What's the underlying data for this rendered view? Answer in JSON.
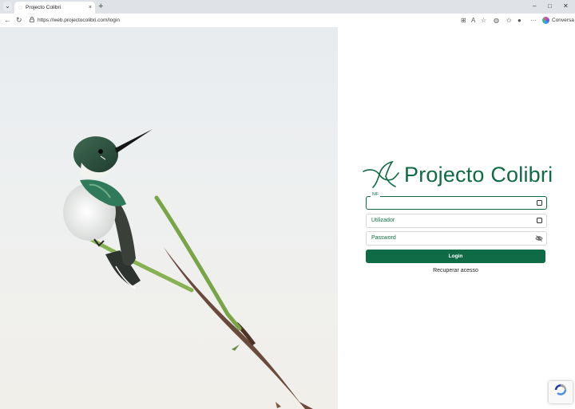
{
  "browser": {
    "tab_title": "Projecto Colibri",
    "tab_close": "×",
    "new_tab": "+",
    "tab_menu": "⌄",
    "url": "https://web.projectocolibri.com/login",
    "toolbar_more": "···",
    "copilot_label": "Conversa",
    "window_controls": {
      "minimize": "–",
      "maximize": "□",
      "close": "✕"
    },
    "nav": {
      "back": "←",
      "refresh": "↻"
    }
  },
  "brand": {
    "name": "Projecto Colibri"
  },
  "form": {
    "nif_label": "NIF",
    "nif_value": "",
    "user_label": "Utilizador",
    "password_label": "Password",
    "login_label": "Login",
    "recover_label": "Recuperar acesso"
  },
  "colors": {
    "brand_green": "#0f6b45",
    "panel_bg": "#ffffff"
  },
  "icons": {
    "lock": "lock-icon",
    "eye": "eye-off-icon",
    "bird_logo": "hummingbird-logo-icon",
    "recaptcha": "recaptcha-icon"
  }
}
